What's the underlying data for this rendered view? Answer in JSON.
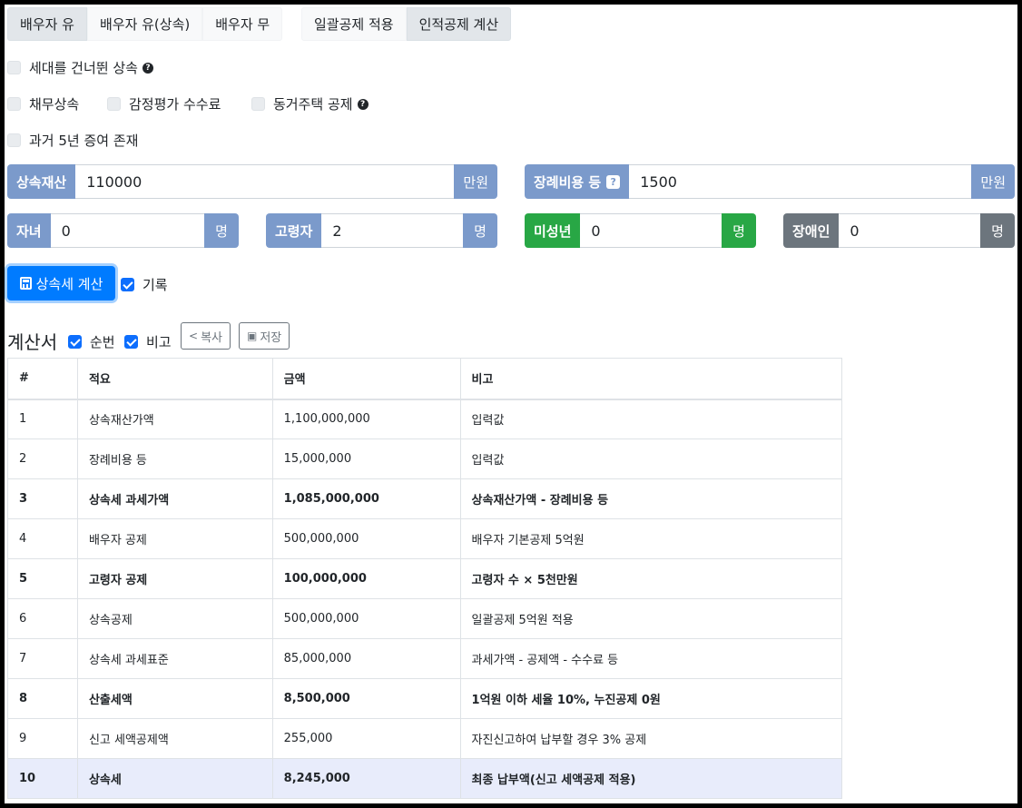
{
  "spouse_group": [
    {
      "label": "배우자 유",
      "active": true
    },
    {
      "label": "배우자 유(상속)",
      "active": false
    },
    {
      "label": "배우자 무",
      "active": false
    }
  ],
  "deduction_group": [
    {
      "label": "일괄공제 적용",
      "active": false
    },
    {
      "label": "인적공제 계산",
      "active": true
    }
  ],
  "options": {
    "generation_skip": "세대를 건너뛴 상속",
    "debt": "채무상속",
    "appraisal_fee": "감정평가 수수료",
    "cohabiting_house": "동거주택 공제",
    "prior_gift": "과거 5년 증여 존재"
  },
  "inputs": {
    "estate": {
      "label": "상속재산",
      "value": "110000",
      "unit": "만원"
    },
    "funeral": {
      "label": "장례비용 등",
      "help": "?",
      "value": "1500",
      "unit": "만원"
    },
    "children": {
      "label": "자녀",
      "value": "0",
      "unit": "명"
    },
    "elderly": {
      "label": "고령자",
      "value": "2",
      "unit": "명"
    },
    "minor": {
      "label": "미성년",
      "value": "0",
      "unit": "명"
    },
    "disabled": {
      "label": "장애인",
      "value": "0",
      "unit": "명"
    }
  },
  "calc_button": "상속세 계산",
  "record_label": "기록",
  "statement": {
    "title": "계산서",
    "seq_label": "순번",
    "note_label": "비고",
    "copy_label": "복사",
    "save_label": "저장"
  },
  "table": {
    "headers": [
      "#",
      "적요",
      "금액",
      "비고"
    ],
    "rows": [
      {
        "no": "1",
        "item": "상속재산가액",
        "amount": "1,100,000,000",
        "note": "입력값",
        "style": ""
      },
      {
        "no": "2",
        "item": "장례비용 등",
        "amount": "15,000,000",
        "note": "입력값",
        "style": ""
      },
      {
        "no": "3",
        "item": "상속세 과세가액",
        "amount": "1,085,000,000",
        "note": "상속재산가액 - 장례비용 등",
        "style": "bold"
      },
      {
        "no": "4",
        "item": "배우자 공제",
        "amount": "500,000,000",
        "note": "배우자 기본공제 5억원",
        "style": ""
      },
      {
        "no": "5",
        "item": "고령자 공제",
        "amount": "100,000,000",
        "note": "고령자 수 × 5천만원",
        "style": "bold"
      },
      {
        "no": "6",
        "item": "상속공제",
        "amount": "500,000,000",
        "note": "일괄공제 5억원 적용",
        "style": ""
      },
      {
        "no": "7",
        "item": "상속세 과세표준",
        "amount": "85,000,000",
        "note": "과세가액 - 공제액 - 수수료 등",
        "style": ""
      },
      {
        "no": "8",
        "item": "산출세액",
        "amount": "8,500,000",
        "note": "1억원 이하 세율 10%, 누진공제 0원",
        "style": "bold"
      },
      {
        "no": "9",
        "item": "신고 세액공제액",
        "amount": "255,000",
        "note": "자진신고하여 납부할 경우 3% 공제",
        "style": ""
      },
      {
        "no": "10",
        "item": "상속세",
        "amount": "8,245,000",
        "note": "최종 납부액(신고 세액공제 적용)",
        "style": "hl"
      }
    ]
  }
}
